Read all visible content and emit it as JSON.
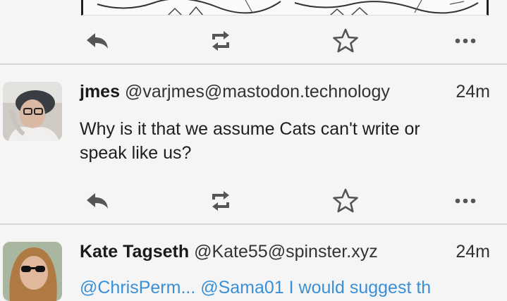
{
  "statuses": [
    {
      "display_name": "jmes",
      "acct": "@varjmes@mastodon.technology",
      "time": "24m",
      "content": "Why is it that we assume Cats can't write or speak like us?"
    },
    {
      "display_name": "Kate Tagseth",
      "acct": "@Kate55@spinster.xyz",
      "time": "24m",
      "content_partial": "@ChrisPerm... @Sama01 I would suggest th"
    }
  ],
  "icons": {
    "reply": "reply-icon",
    "boost": "boost-icon",
    "favourite": "star-icon",
    "more": "more-icon"
  },
  "colors": {
    "background": "#f5f5f5",
    "icon": "#555555",
    "link": "#3a8fd6",
    "divider": "#d6d6d6"
  }
}
